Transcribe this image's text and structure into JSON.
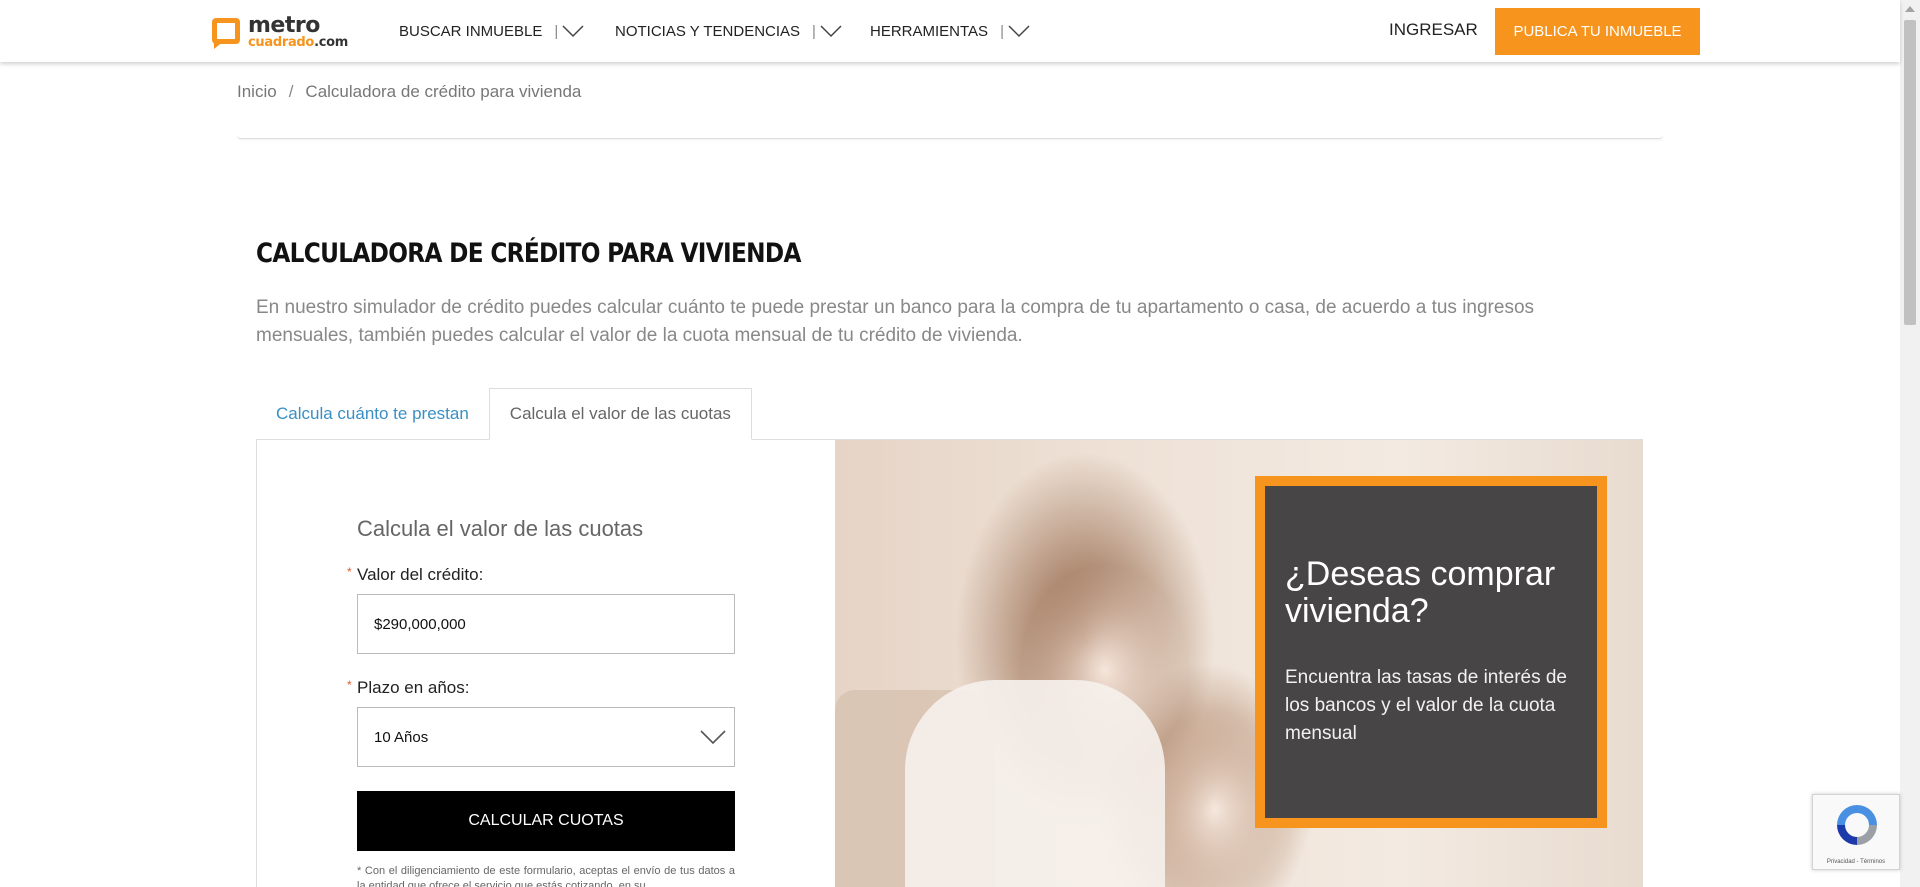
{
  "header": {
    "logo": {
      "line1": "metro",
      "line2": "cuadrado",
      "suffix": ".com"
    },
    "nav": [
      {
        "label": "BUSCAR INMUEBLE",
        "sep": "|"
      },
      {
        "label": "NOTICIAS Y TENDENCIAS",
        "sep": "|"
      },
      {
        "label": "HERRAMIENTAS",
        "sep": "|"
      }
    ],
    "login_label": "INGRESAR",
    "publish_label": "PUBLICA TU INMUEBLE"
  },
  "breadcrumb": {
    "home": "Inicio",
    "separator": "/",
    "current": "Calculadora de crédito para vivienda"
  },
  "page": {
    "title": "CALCULADORA DE CRÉDITO PARA VIVIENDA",
    "intro": "En nuestro simulador de crédito puedes calcular cuánto te puede prestar un banco para la compra de tu apartamento o casa, de acuerdo a tus ingresos mensuales, también puedes calcular el valor de la cuota mensual de tu crédito de vivienda."
  },
  "tabs": [
    {
      "label": "Calcula cuánto te prestan",
      "active": false
    },
    {
      "label": "Calcula el valor de las cuotas",
      "active": true
    }
  ],
  "form": {
    "title": "Calcula el valor de las cuotas",
    "required_mark": "*",
    "credit_label": "Valor del crédito:",
    "credit_value": "$290,000,000",
    "term_label": "Plazo en años:",
    "term_value": "10 Años",
    "submit_label": "CALCULAR CUOTAS",
    "disclaimer": "* Con el diligenciamiento de este formulario, aceptas el envío de tus datos a la entidad que ofrece el servicio que estás cotizando, en su"
  },
  "promo": {
    "title": "¿Deseas comprar vivienda?",
    "text": "Encuentra las tasas de interés de los bancos y el valor de la cuota mensual"
  },
  "recaptcha": {
    "text": "Privacidad - Términos"
  },
  "colors": {
    "accent": "#f7941d",
    "link": "#3a8fc4",
    "promo_bg": "#474545",
    "button": "#000000"
  }
}
